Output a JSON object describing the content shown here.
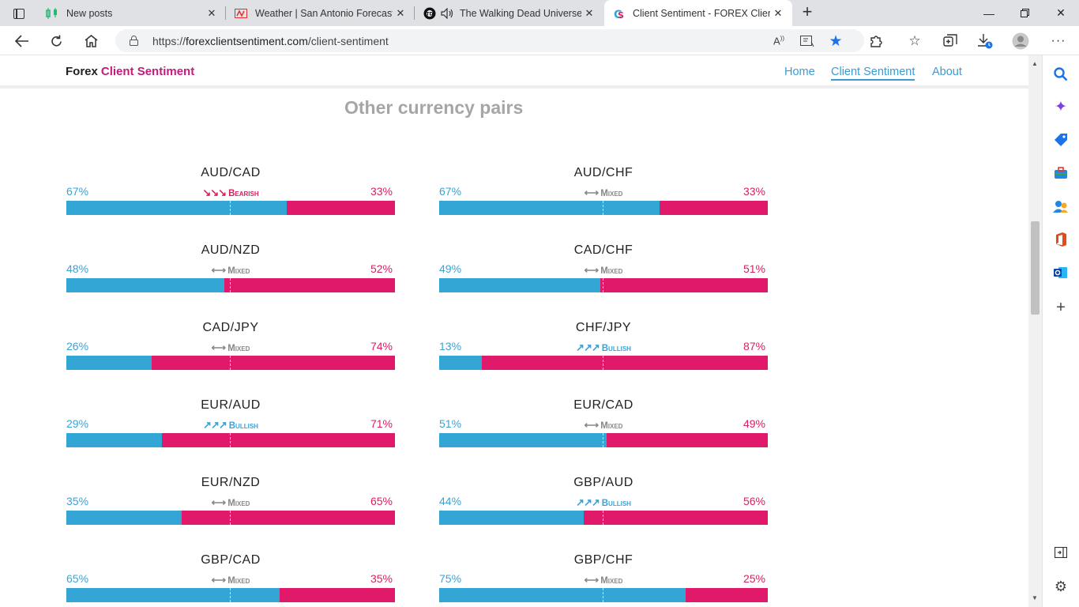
{
  "browser": {
    "tabs": [
      {
        "title": "New posts",
        "icon": "candles-icon",
        "active": false
      },
      {
        "title": "Weather | San Antonio Forecast, ",
        "icon": "weather-logo-icon",
        "active": false
      },
      {
        "title": "The Walking Dead Universe",
        "icon": "twd-logo-icon",
        "active": false,
        "audio": true
      },
      {
        "title": "Client Sentiment - FOREX Client S",
        "icon": "cs-logo-icon",
        "active": true
      }
    ],
    "url_prefix": "https://",
    "url_host": "forexclientsentiment.com",
    "url_path": "/client-sentiment"
  },
  "site": {
    "brand_part1": "Forex",
    "brand_part2": "Client Sentiment",
    "nav": [
      "Home",
      "Client Sentiment",
      "About"
    ],
    "section_title": "Other currency pairs"
  },
  "pairs": [
    {
      "name": "AUD/CAD",
      "long": "67%",
      "short": "33%",
      "long_value": 67,
      "sentiment": "Bearish",
      "type": "bear",
      "icon": "↘↘↘"
    },
    {
      "name": "AUD/CHF",
      "long": "67%",
      "short": "33%",
      "long_value": 67,
      "sentiment": "Mixed",
      "type": "mixed",
      "icon": "⟷"
    },
    {
      "name": "AUD/NZD",
      "long": "48%",
      "short": "52%",
      "long_value": 48,
      "sentiment": "Mixed",
      "type": "mixed",
      "icon": "⟷"
    },
    {
      "name": "CAD/CHF",
      "long": "49%",
      "short": "51%",
      "long_value": 49,
      "sentiment": "Mixed",
      "type": "mixed",
      "icon": "⟷"
    },
    {
      "name": "CAD/JPY",
      "long": "26%",
      "short": "74%",
      "long_value": 26,
      "sentiment": "Mixed",
      "type": "mixed",
      "icon": "⟷"
    },
    {
      "name": "CHF/JPY",
      "long": "13%",
      "short": "87%",
      "long_value": 13,
      "sentiment": "Bullish",
      "type": "bull",
      "icon": "↗↗↗"
    },
    {
      "name": "EUR/AUD",
      "long": "29%",
      "short": "71%",
      "long_value": 29,
      "sentiment": "Bullish",
      "type": "bull",
      "icon": "↗↗↗"
    },
    {
      "name": "EUR/CAD",
      "long": "51%",
      "short": "49%",
      "long_value": 51,
      "sentiment": "Mixed",
      "type": "mixed",
      "icon": "⟷"
    },
    {
      "name": "EUR/NZD",
      "long": "35%",
      "short": "65%",
      "long_value": 35,
      "sentiment": "Mixed",
      "type": "mixed",
      "icon": "⟷"
    },
    {
      "name": "GBP/AUD",
      "long": "44%",
      "short": "56%",
      "long_value": 44,
      "sentiment": "Bullish",
      "type": "bull",
      "icon": "↗↗↗"
    },
    {
      "name": "GBP/CAD",
      "long": "65%",
      "short": "35%",
      "long_value": 65,
      "sentiment": "Mixed",
      "type": "mixed",
      "icon": "⟷"
    },
    {
      "name": "GBP/CHF",
      "long": "75%",
      "short": "25%",
      "long_value": 75,
      "sentiment": "Mixed",
      "type": "mixed",
      "icon": "⟷"
    }
  ]
}
